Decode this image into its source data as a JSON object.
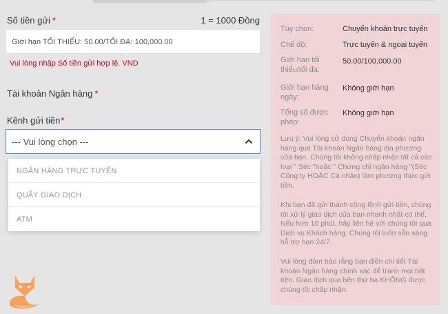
{
  "form": {
    "amount_label": "Số tiền gửi",
    "required_mark": "*",
    "rate": "1 = 1000 Đồng",
    "amount_placeholder": "Giới hạn TỐI THIỂU: 50.00/TỐI ĐA: 100,000.00",
    "amount_error": "Vui lòng nhập Số tiền gửi hợp lệ. VND",
    "bank_label": "Tài khoản Ngân hàng",
    "channel_label": "Kênh gửi tiền",
    "channel_selected": "--- Vui lòng chọn ---",
    "channel_options": [
      "NGÂN HÀNG TRỰC TUYẾN",
      "QUẦY GIAO DỊCH",
      "ATM"
    ]
  },
  "info": {
    "rows": [
      {
        "key": "Tùy chọn:",
        "value": "Chuyển khoản trực tuyến"
      },
      {
        "key": "Chế độ:",
        "value": "Trực tuyến & ngoại tuyến"
      },
      {
        "key": "Giới hạn tối thiểu/tối đa:",
        "value": "50.00/100,000.00"
      },
      {
        "key": "Giới hạn hàng ngày:",
        "value": "Không giới hạn"
      },
      {
        "key": "Tổng số được phép:",
        "value": "Không giới hạn"
      }
    ],
    "notes": [
      "Lưu ý: Vui lòng sử dụng Chuyển khoản ngân hàng qua Tài khoản Ngân hàng địa phương của bạn. Chúng tôi không chấp nhận tất cả các loại \" Séc \"hoặc \" Chứng chỉ ngân hàng \"(Séc Công ty HOẶC Cá nhân) làm phương thức gửi tiền.",
      "Khi bạn đã gửi thành công lệnh gửi tiền, chúng tôi xử lý giao dịch của bạn nhanh nhất có thể. Nếu hơn 10 phút, hãy liên hệ với chúng tôi qua Dịch vụ Khách hàng. Chúng tôi luôn sẵn sàng hỗ trợ bạn 24/7.",
      "Vui lòng đảm bảo rằng bạn điền chi tiết Tài khoản Ngân hàng chính xác để tránh mọi bất tiện. Giao dịch qua bên thứ ba KHÔNG được chúng tôi chấp nhận."
    ]
  },
  "icons": {
    "chevron": "chevron-up-icon",
    "logo": "fox-logo-icon"
  },
  "colors": {
    "required": "#d0021b",
    "error": "#d0021b",
    "info_bg": "#f0d4d8",
    "select_border": "#4a90e2",
    "fox": "#f5a25d"
  }
}
